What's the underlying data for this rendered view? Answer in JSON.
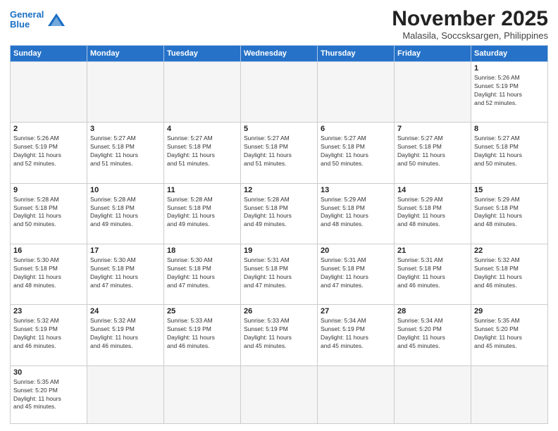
{
  "logo": {
    "line1": "General",
    "line2": "Blue"
  },
  "title": "November 2025",
  "location": "Malasila, Soccsksargen, Philippines",
  "days_of_week": [
    "Sunday",
    "Monday",
    "Tuesday",
    "Wednesday",
    "Thursday",
    "Friday",
    "Saturday"
  ],
  "weeks": [
    [
      {
        "day": "",
        "info": ""
      },
      {
        "day": "",
        "info": ""
      },
      {
        "day": "",
        "info": ""
      },
      {
        "day": "",
        "info": ""
      },
      {
        "day": "",
        "info": ""
      },
      {
        "day": "",
        "info": ""
      },
      {
        "day": "1",
        "info": "Sunrise: 5:26 AM\nSunset: 5:19 PM\nDaylight: 11 hours\nand 52 minutes."
      }
    ],
    [
      {
        "day": "2",
        "info": "Sunrise: 5:26 AM\nSunset: 5:19 PM\nDaylight: 11 hours\nand 52 minutes."
      },
      {
        "day": "3",
        "info": "Sunrise: 5:27 AM\nSunset: 5:18 PM\nDaylight: 11 hours\nand 51 minutes."
      },
      {
        "day": "4",
        "info": "Sunrise: 5:27 AM\nSunset: 5:18 PM\nDaylight: 11 hours\nand 51 minutes."
      },
      {
        "day": "5",
        "info": "Sunrise: 5:27 AM\nSunset: 5:18 PM\nDaylight: 11 hours\nand 51 minutes."
      },
      {
        "day": "6",
        "info": "Sunrise: 5:27 AM\nSunset: 5:18 PM\nDaylight: 11 hours\nand 50 minutes."
      },
      {
        "day": "7",
        "info": "Sunrise: 5:27 AM\nSunset: 5:18 PM\nDaylight: 11 hours\nand 50 minutes."
      },
      {
        "day": "8",
        "info": "Sunrise: 5:27 AM\nSunset: 5:18 PM\nDaylight: 11 hours\nand 50 minutes."
      }
    ],
    [
      {
        "day": "9",
        "info": "Sunrise: 5:28 AM\nSunset: 5:18 PM\nDaylight: 11 hours\nand 50 minutes."
      },
      {
        "day": "10",
        "info": "Sunrise: 5:28 AM\nSunset: 5:18 PM\nDaylight: 11 hours\nand 49 minutes."
      },
      {
        "day": "11",
        "info": "Sunrise: 5:28 AM\nSunset: 5:18 PM\nDaylight: 11 hours\nand 49 minutes."
      },
      {
        "day": "12",
        "info": "Sunrise: 5:28 AM\nSunset: 5:18 PM\nDaylight: 11 hours\nand 49 minutes."
      },
      {
        "day": "13",
        "info": "Sunrise: 5:29 AM\nSunset: 5:18 PM\nDaylight: 11 hours\nand 48 minutes."
      },
      {
        "day": "14",
        "info": "Sunrise: 5:29 AM\nSunset: 5:18 PM\nDaylight: 11 hours\nand 48 minutes."
      },
      {
        "day": "15",
        "info": "Sunrise: 5:29 AM\nSunset: 5:18 PM\nDaylight: 11 hours\nand 48 minutes."
      }
    ],
    [
      {
        "day": "16",
        "info": "Sunrise: 5:30 AM\nSunset: 5:18 PM\nDaylight: 11 hours\nand 48 minutes."
      },
      {
        "day": "17",
        "info": "Sunrise: 5:30 AM\nSunset: 5:18 PM\nDaylight: 11 hours\nand 47 minutes."
      },
      {
        "day": "18",
        "info": "Sunrise: 5:30 AM\nSunset: 5:18 PM\nDaylight: 11 hours\nand 47 minutes."
      },
      {
        "day": "19",
        "info": "Sunrise: 5:31 AM\nSunset: 5:18 PM\nDaylight: 11 hours\nand 47 minutes."
      },
      {
        "day": "20",
        "info": "Sunrise: 5:31 AM\nSunset: 5:18 PM\nDaylight: 11 hours\nand 47 minutes."
      },
      {
        "day": "21",
        "info": "Sunrise: 5:31 AM\nSunset: 5:18 PM\nDaylight: 11 hours\nand 46 minutes."
      },
      {
        "day": "22",
        "info": "Sunrise: 5:32 AM\nSunset: 5:18 PM\nDaylight: 11 hours\nand 46 minutes."
      }
    ],
    [
      {
        "day": "23",
        "info": "Sunrise: 5:32 AM\nSunset: 5:19 PM\nDaylight: 11 hours\nand 46 minutes."
      },
      {
        "day": "24",
        "info": "Sunrise: 5:32 AM\nSunset: 5:19 PM\nDaylight: 11 hours\nand 46 minutes."
      },
      {
        "day": "25",
        "info": "Sunrise: 5:33 AM\nSunset: 5:19 PM\nDaylight: 11 hours\nand 46 minutes."
      },
      {
        "day": "26",
        "info": "Sunrise: 5:33 AM\nSunset: 5:19 PM\nDaylight: 11 hours\nand 45 minutes."
      },
      {
        "day": "27",
        "info": "Sunrise: 5:34 AM\nSunset: 5:19 PM\nDaylight: 11 hours\nand 45 minutes."
      },
      {
        "day": "28",
        "info": "Sunrise: 5:34 AM\nSunset: 5:20 PM\nDaylight: 11 hours\nand 45 minutes."
      },
      {
        "day": "29",
        "info": "Sunrise: 5:35 AM\nSunset: 5:20 PM\nDaylight: 11 hours\nand 45 minutes."
      }
    ],
    [
      {
        "day": "30",
        "info": "Sunrise: 5:35 AM\nSunset: 5:20 PM\nDaylight: 11 hours\nand 45 minutes."
      },
      {
        "day": "",
        "info": ""
      },
      {
        "day": "",
        "info": ""
      },
      {
        "day": "",
        "info": ""
      },
      {
        "day": "",
        "info": ""
      },
      {
        "day": "",
        "info": ""
      },
      {
        "day": "",
        "info": ""
      }
    ]
  ]
}
